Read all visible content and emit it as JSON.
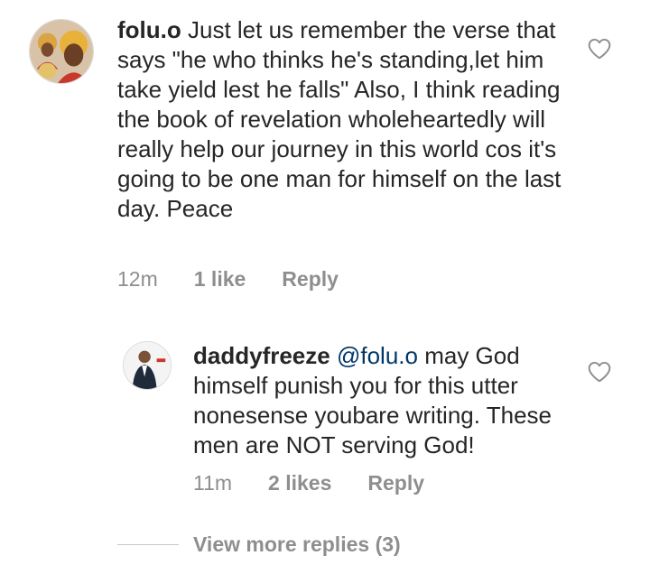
{
  "comments": [
    {
      "username": "folu.o",
      "text": "Just let us remember the verse that says \"he who thinks he's standing,let him take yield lest he falls\" Also, I think reading the book of revelation wholeheartedly will really help our journey in this world cos it's going to be one man for himself on the last day. Peace",
      "time": "12m",
      "likes": "1 like",
      "reply_label": "Reply",
      "avatar_icon": "avatar-image",
      "like_icon": "heart-outline-icon"
    }
  ],
  "reply": {
    "username": "daddyfreeze",
    "mention": "@folu.o",
    "text": "may God himself punish you for this utter nonesense youbare writing. These men are NOT serving God!",
    "time": "11m",
    "likes": "2 likes",
    "reply_label": "Reply",
    "avatar_icon": "avatar-image",
    "like_icon": "heart-outline-icon"
  },
  "view_more_replies": "View more replies (3)",
  "colors": {
    "text": "#262626",
    "meta": "#8e8e8e",
    "mention": "#00376b",
    "divider": "#c7c7c7"
  }
}
